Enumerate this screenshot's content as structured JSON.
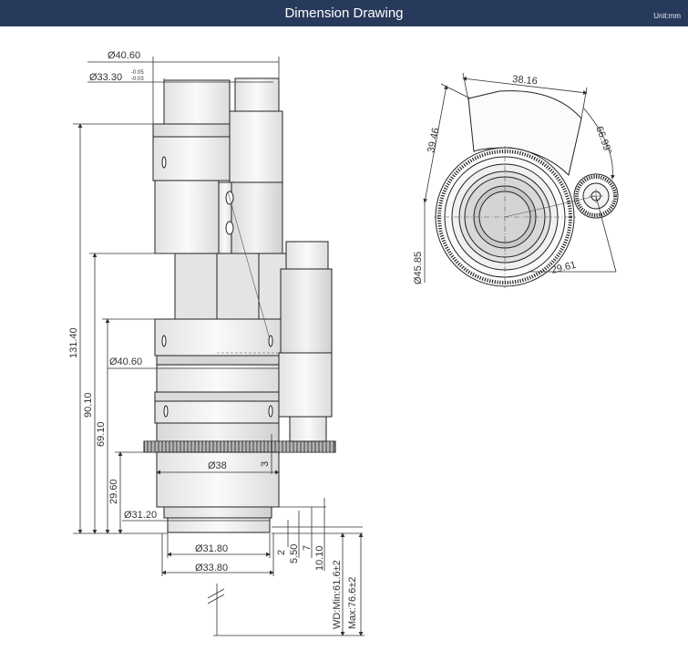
{
  "header": {
    "title": "Dimension Drawing",
    "unit": "Unit:mm"
  },
  "side_view": {
    "dia_top": "Ø40.60",
    "dia_flange": "Ø33.30",
    "tol_upper": "-0.05",
    "tol_lower": "-0.03",
    "height_total": "131.40",
    "height_2": "90.10",
    "height_3": "69.10",
    "height_4": "29.60",
    "dia_mid": "Ø40.60",
    "dia_gear_body": "Ø38",
    "gear_width": "3",
    "dia_thread": "Ø31.20",
    "dia_bottom_inner": "Ø31.80",
    "dia_bottom_outer": "Ø33.80",
    "len_a": "2",
    "len_b": "5.50",
    "len_c": "7",
    "len_d": "10.10",
    "wd_min": "WD:Min:61.6±2",
    "wd_max": "Max:76.6±2"
  },
  "top_view": {
    "width": "38.16",
    "height": "39.46",
    "angle": "66.99°",
    "dia_gear": "Ø45.85",
    "radius": "29.61"
  }
}
